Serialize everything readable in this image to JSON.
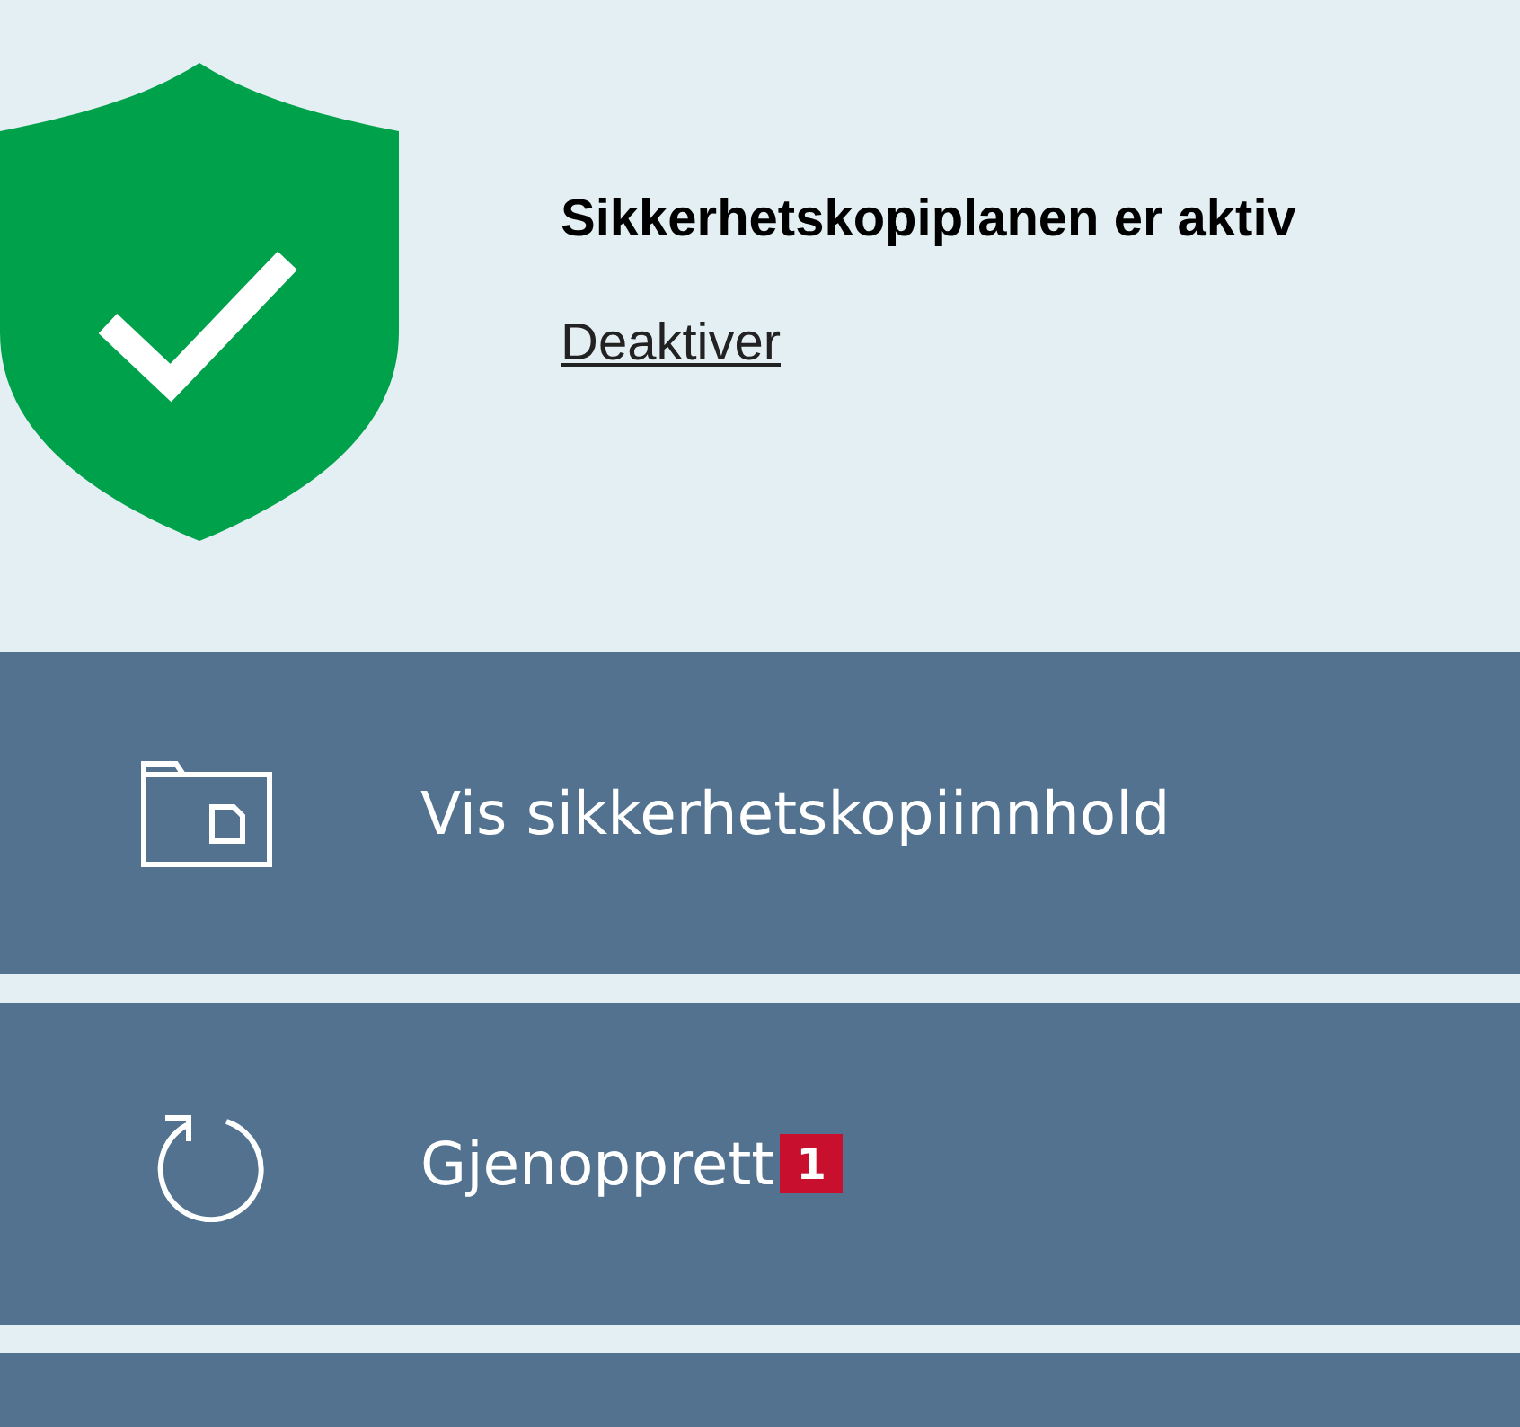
{
  "status": {
    "title": "Sikkerhetskopiplanen er aktiv",
    "link": "Deaktiver"
  },
  "actions": [
    {
      "kind": "folder",
      "label": "Vis sikkerhetskopiinnhold"
    },
    {
      "kind": "restore",
      "label": "Gjenopprett",
      "badge": "1"
    },
    {
      "kind": "empty"
    }
  ]
}
